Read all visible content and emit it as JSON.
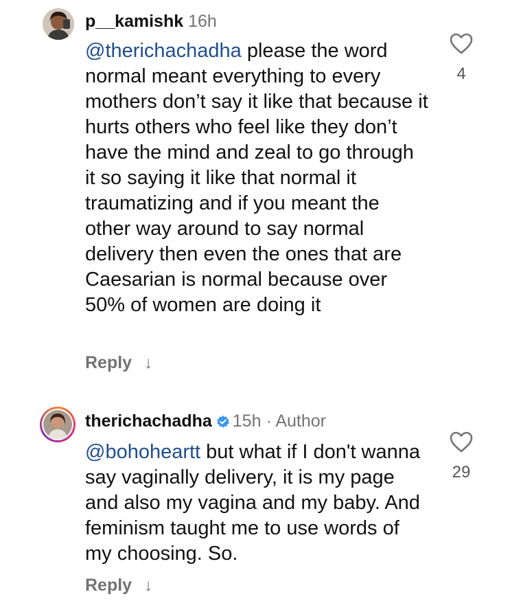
{
  "comments": [
    {
      "username": "p__kamishk",
      "time": "16h",
      "author_tag": "",
      "mention": "@therichachadha",
      "text": " please the word normal meant everything to every mothers don’t say it like that because it hurts others who feel like they don’t have the mind and zeal to go through it so saying it like that normal it traumatizing and if you meant the other way around to say normal delivery then even the ones that are Caesarian is normal because over 50% of women are doing it",
      "reply_label": "Reply",
      "likes": "4",
      "verified": false
    },
    {
      "username": "therichachadha",
      "time": "15h",
      "author_tag": " · Author",
      "mention": "@bohoheartt",
      "text": " but what if I don't wanna say vaginally delivery, it is my page and also my vagina and my baby. And feminism taught me to use words of my choosing. So.",
      "reply_label": "Reply",
      "likes": "29",
      "verified": true
    }
  ],
  "icons": {
    "like": "heart-outline-icon",
    "expand": "arrow-down-icon",
    "verified": "verified-badge-icon"
  },
  "colors": {
    "mention": "#1f4e8f",
    "meta": "#737373",
    "verified": "#3897f0"
  }
}
